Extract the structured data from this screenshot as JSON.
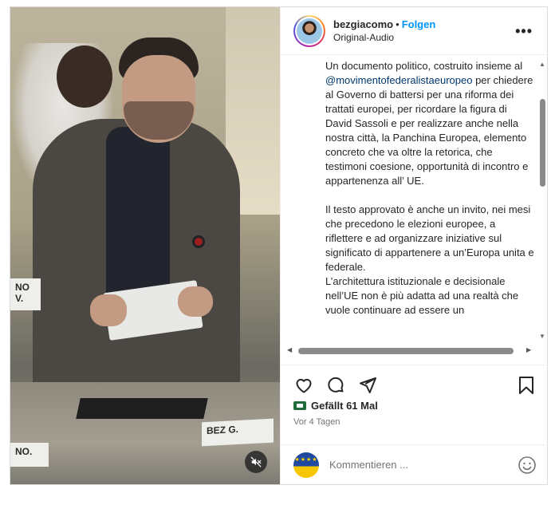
{
  "post": {
    "username": "bezgiacomo",
    "separator": "•",
    "follow_label": "Folgen",
    "audio_label": "Original-Audio",
    "more_label": "•••",
    "caption_part1": "Un documento politico, costruito insieme al ",
    "mention": "@movimentofederalistaeuropeo",
    "caption_part2": " per chiedere al Governo di battersi per una riforma dei trattati europei, per ricordare la figura di David Sassoli e per realizzare anche nella nostra città, la Panchina Europea, elemento concreto che va oltre la retorica, che testimoni coesione, opportunità di incontro e appartenenza all’ UE.\n\nIl testo approvato è anche un invito, nei mesi che precedono le elezioni europee, a riflettere e ad organizzare iniziative sul significato di appartenere a un’Europa unita e federale.\nL’architettura istituzionale e decisionale nell’UE non è più adatta ad una realtà che vuole continuare ad essere un",
    "likes_label": "Gefällt 61 Mal",
    "time_ago": "Vor 4 Tagen",
    "comment_placeholder": "Kommentieren ..."
  },
  "video": {
    "sign_1": "BEZ G.",
    "sign_2": "NO.",
    "sign_3": "NO V."
  },
  "icons": {
    "like": "heart-icon",
    "comment": "comment-icon",
    "share": "send-icon",
    "save": "bookmark-icon",
    "mute": "speaker-muted-icon",
    "emoji": "smiley-icon"
  },
  "colors": {
    "follow": "#0095f6",
    "mention": "#00376b",
    "muted_text": "#737373"
  }
}
